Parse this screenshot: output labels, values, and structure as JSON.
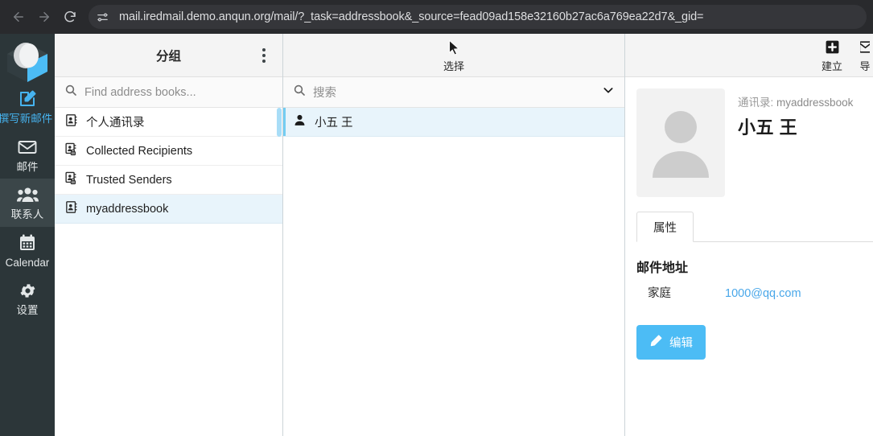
{
  "browser": {
    "back_icon": "back-arrow-icon",
    "forward_icon": "forward-arrow-icon",
    "reload_icon": "reload-icon",
    "site_info_icon": "site-settings-icon",
    "url": "mail.iredmail.demo.anqun.org/mail/?_task=addressbook&_source=fead09ad158e32160b27ac6a769ea22d7&_gid="
  },
  "colors": {
    "sidebar_bg": "#2c3639",
    "accent": "#46b3ef",
    "selected_row_bg": "#e8f4fb",
    "link": "#49a7e9",
    "button_primary": "#4cbcf5",
    "chrome_bg": "#292a2d"
  },
  "tasksidebar": {
    "logo_name": "roundcube-logo",
    "items": [
      {
        "label": "撰写新邮件",
        "icon": "compose-icon",
        "state": "accent"
      },
      {
        "label": "邮件",
        "icon": "envelope-icon",
        "state": "plain"
      },
      {
        "label": "联系人",
        "icon": "contacts-icon",
        "state": "selected"
      },
      {
        "label": "Calendar",
        "icon": "calendar-icon",
        "state": "plain"
      },
      {
        "label": "设置",
        "icon": "gear-icon",
        "state": "plain"
      }
    ]
  },
  "groups_panel": {
    "title": "分组",
    "menu_icon": "options-menu-icon",
    "search": {
      "placeholder": "Find address books...",
      "icon": "search-icon",
      "value": ""
    },
    "items": [
      {
        "label": "个人通讯录",
        "icon": "addressbook-icon",
        "selected": false
      },
      {
        "label": "Collected Recipients",
        "icon": "addressbook-lock-icon",
        "selected": false
      },
      {
        "label": "Trusted Senders",
        "icon": "addressbook-lock-icon",
        "selected": false
      },
      {
        "label": "myaddressbook",
        "icon": "addressbook-icon",
        "selected": true
      }
    ]
  },
  "contacts_panel": {
    "select_label": "选择",
    "select_icon": "cursor-arrow-icon",
    "search": {
      "placeholder": "搜索",
      "icon": "search-icon",
      "value": "",
      "options_icon": "chevron-down-icon"
    },
    "rows": [
      {
        "name": "小五 王",
        "icon": "contact-person-icon",
        "selected": true
      }
    ]
  },
  "detail_panel": {
    "actions": [
      {
        "label": "建立",
        "icon": "plus-square-icon"
      }
    ],
    "photo_icon": "contact-photo-placeholder-icon",
    "source_label": "通讯录:",
    "source_value": "myaddressbook",
    "contact_name": "小五 王",
    "tabs": [
      {
        "label": "属性",
        "active": true
      }
    ],
    "properties": {
      "group_title": "邮件地址",
      "rows": [
        {
          "label": "家庭",
          "value": "1000@qq.com",
          "is_link": true
        }
      ]
    },
    "edit_button": {
      "label": "编辑",
      "icon": "pencil-icon"
    }
  }
}
